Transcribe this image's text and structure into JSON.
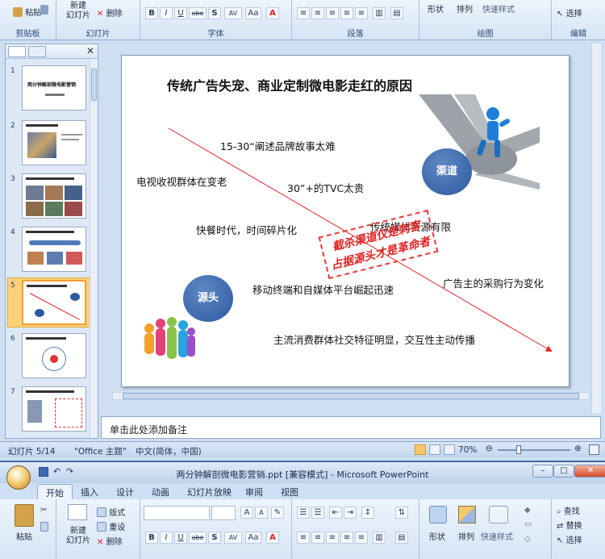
{
  "top_ribbon": {
    "paste": "粘贴",
    "new_slide_line1": "新建",
    "new_slide_line2": "幻灯片",
    "delete": "删除",
    "shape": "形状",
    "arrange": "排列",
    "quick_styles": "快速样式",
    "select": "选择",
    "groups": {
      "clipboard": "剪贴板",
      "slides": "幻灯片",
      "font": "字体",
      "paragraph": "段落",
      "drawing": "绘图",
      "editing": "编辑"
    },
    "font_buttons": [
      "B",
      "I",
      "U",
      "abe",
      "S",
      "AV",
      "Aa"
    ]
  },
  "slide_pane": {
    "thumb_numbers": [
      "1",
      "2",
      "3",
      "4",
      "5",
      "6",
      "7"
    ],
    "thumb1_title": "两分钟解剖微电影营销"
  },
  "slide": {
    "title": "传统广告失宠、商业定制微电影走红的原因",
    "texts": {
      "t1": "15-30“阐述品牌故事太难",
      "t2": "电视收视群体在变老",
      "t3": "30”+的TVC太贵",
      "t4": "快餐时代，时间碎片化",
      "t5": "传统媒体资源有限",
      "t6": "移动终端和自媒体平台崛起迅速",
      "t7": "广告主的采购行为变化",
      "t8": "主流消费群体社交特征明显，交互性主动传播"
    },
    "channel_label": "渠道",
    "source_label": "源头",
    "stamp_line1": "截杀渠道仅是刺客",
    "stamp_line2": "占据源头才是革命者"
  },
  "notes": {
    "placeholder": "单击此处添加备注"
  },
  "status": {
    "slide_position": "幻灯片 5/14",
    "theme": "\"Office 主题\"",
    "language": "中文(简体，中国)",
    "zoom": "70%"
  },
  "window2": {
    "title": "两分钟解剖微电影营销.ppt [兼容模式] - Microsoft PowerPoint",
    "tabs": [
      "开始",
      "插入",
      "设计",
      "动画",
      "幻灯片放映",
      "审阅",
      "视图"
    ],
    "paste": "粘贴",
    "new_slide_line1": "新建",
    "new_slide_line2": "幻灯片",
    "layout": "版式",
    "reset": "重设",
    "delete": "删除",
    "shape": "形状",
    "arrange": "排列",
    "quick_styles": "快速样式",
    "find": "查找",
    "replace": "替换",
    "select": "选择",
    "font_buttons": [
      "B",
      "I",
      "U",
      "abe",
      "S",
      "AV",
      "Aa"
    ]
  },
  "colors": {
    "accent_orange": "#f0a030",
    "arrow_red": "#e02424",
    "circle_blue": "#2b5aa0"
  }
}
